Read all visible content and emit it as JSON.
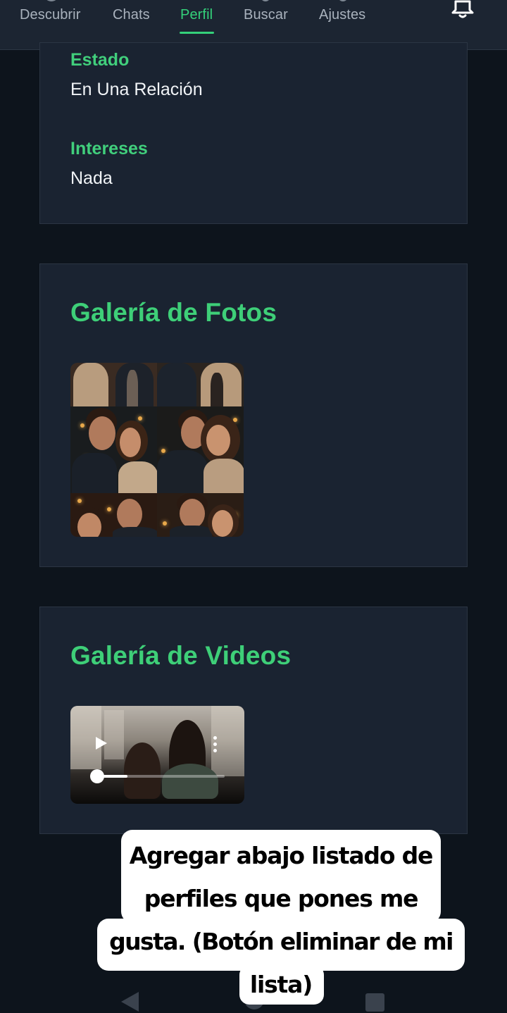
{
  "topnav": {
    "items": [
      {
        "label": "Descubrir",
        "active": false
      },
      {
        "label": "Chats",
        "active": false
      },
      {
        "label": "Perfil",
        "active": true
      },
      {
        "label": "Buscar",
        "active": false
      },
      {
        "label": "Ajustes",
        "active": false
      }
    ],
    "bell_icon": "bell-icon",
    "accent_color": "#34d17a"
  },
  "profile_info": {
    "fields": [
      {
        "label": "Estado",
        "value": "En Una Relación"
      },
      {
        "label": "Intereses",
        "value": "Nada"
      }
    ]
  },
  "photo_gallery": {
    "title": "Galería de Fotos"
  },
  "video_gallery": {
    "title": "Galería de Videos",
    "progress": 0.24,
    "play_icon": "play-icon",
    "menu_icon": "more-vertical-icon"
  },
  "annotation": {
    "lines": [
      "Agregar abajo listado de",
      "perfiles que pones me",
      "gusta. (Botón eliminar de mi",
      "lista)"
    ]
  },
  "system_nav": {
    "icons": [
      "back-icon",
      "home-icon",
      "recents-icon"
    ]
  }
}
